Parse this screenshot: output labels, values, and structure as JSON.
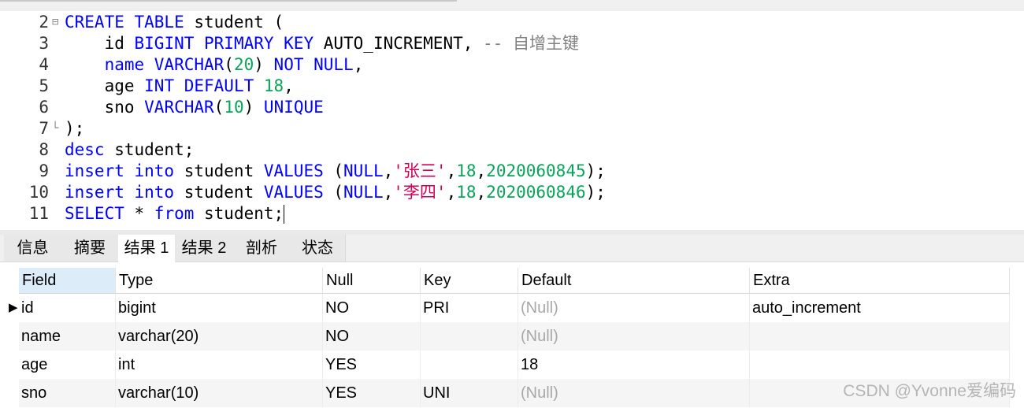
{
  "editor": {
    "lines": [
      {
        "num": "2",
        "fold": "⊟",
        "tokens": [
          [
            "kw",
            "CREATE TABLE"
          ],
          [
            "t",
            " student ("
          ]
        ]
      },
      {
        "num": "3",
        "fold": "",
        "tokens": [
          [
            "t",
            "    id "
          ],
          [
            "kw",
            "BIGINT PRIMARY KEY"
          ],
          [
            "t",
            " AUTO_INCREMENT, "
          ],
          [
            "cmt",
            "-- 自增主键"
          ]
        ]
      },
      {
        "num": "4",
        "fold": "",
        "tokens": [
          [
            "t",
            "    "
          ],
          [
            "kw",
            "name VARCHAR"
          ],
          [
            "t",
            "("
          ],
          [
            "num",
            "20"
          ],
          [
            "t",
            ") "
          ],
          [
            "kw",
            "NOT NULL"
          ],
          [
            "t",
            ","
          ]
        ]
      },
      {
        "num": "5",
        "fold": "",
        "tokens": [
          [
            "t",
            "    age "
          ],
          [
            "kw",
            "INT DEFAULT"
          ],
          [
            "t",
            " "
          ],
          [
            "num",
            "18"
          ],
          [
            "t",
            ","
          ]
        ]
      },
      {
        "num": "6",
        "fold": "",
        "tokens": [
          [
            "t",
            "    sno "
          ],
          [
            "kw",
            "VARCHAR"
          ],
          [
            "t",
            "("
          ],
          [
            "num",
            "10"
          ],
          [
            "t",
            ") "
          ],
          [
            "kw",
            "UNIQUE"
          ]
        ]
      },
      {
        "num": "7",
        "fold": "└",
        "tokens": [
          [
            "t",
            ");"
          ]
        ]
      },
      {
        "num": "8",
        "fold": "",
        "tokens": [
          [
            "kw",
            "desc"
          ],
          [
            "t",
            " student;"
          ]
        ]
      },
      {
        "num": "9",
        "fold": "",
        "tokens": [
          [
            "kw",
            "insert into"
          ],
          [
            "t",
            " student "
          ],
          [
            "kw",
            "VALUES"
          ],
          [
            "t",
            " ("
          ],
          [
            "kw",
            "NULL"
          ],
          [
            "t",
            ","
          ],
          [
            "str",
            "'张三'"
          ],
          [
            "t",
            ","
          ],
          [
            "num",
            "18"
          ],
          [
            "t",
            ","
          ],
          [
            "num",
            "2020060845"
          ],
          [
            "t",
            ");"
          ]
        ]
      },
      {
        "num": "10",
        "fold": "",
        "tokens": [
          [
            "kw",
            "insert into"
          ],
          [
            "t",
            " student "
          ],
          [
            "kw",
            "VALUES"
          ],
          [
            "t",
            " ("
          ],
          [
            "kw",
            "NULL"
          ],
          [
            "t",
            ","
          ],
          [
            "str",
            "'李四'"
          ],
          [
            "t",
            ","
          ],
          [
            "num",
            "18"
          ],
          [
            "t",
            ","
          ],
          [
            "num",
            "2020060846"
          ],
          [
            "t",
            ");"
          ]
        ]
      },
      {
        "num": "11",
        "fold": "",
        "tokens": [
          [
            "kw",
            "SELECT"
          ],
          [
            "t",
            " * "
          ],
          [
            "kw",
            "from"
          ],
          [
            "t",
            " student;"
          ]
        ]
      }
    ]
  },
  "tabs": [
    "信息",
    "摘要",
    "结果 1",
    "结果 2",
    "剖析",
    "状态"
  ],
  "active_tab": 2,
  "table": {
    "columns": [
      "Field",
      "Type",
      "Null",
      "Key",
      "Default",
      "Extra"
    ],
    "rows": [
      [
        "id",
        "bigint",
        "NO",
        "PRI",
        "(Null)",
        "auto_increment"
      ],
      [
        "name",
        "varchar(20)",
        "NO",
        "",
        "(Null)",
        ""
      ],
      [
        "age",
        "int",
        "YES",
        "",
        "18",
        ""
      ],
      [
        "sno",
        "varchar(10)",
        "YES",
        "UNI",
        "(Null)",
        ""
      ]
    ]
  },
  "watermark": "CSDN @Yvonne爱编码",
  "colors": {
    "keyword": "#0000ff",
    "number": "#09a35a",
    "string": "#d0005a",
    "comment": "#808080",
    "null": "#a8a8a8",
    "selected_header": "#dcecf9"
  }
}
